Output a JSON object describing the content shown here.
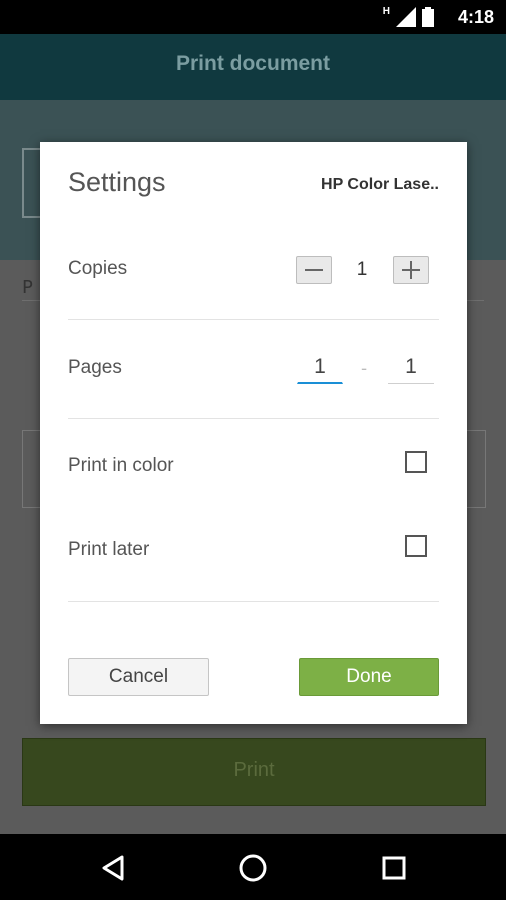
{
  "status_bar": {
    "time": "4:18",
    "network_indicator": "H",
    "icons": [
      "signal-icon",
      "battery-icon"
    ]
  },
  "app_bar": {
    "title": "Print document"
  },
  "background": {
    "print_button_label": "Print"
  },
  "dialog": {
    "title": "Settings",
    "printer": "HP Color Lase..",
    "copies": {
      "label": "Copies",
      "value": "1",
      "minus_icon": "minus-icon",
      "plus_icon": "plus-icon"
    },
    "pages": {
      "label": "Pages",
      "from": "1",
      "separator": "-",
      "to": "1"
    },
    "print_in_color": {
      "label": "Print in color",
      "checked": false
    },
    "print_later": {
      "label": "Print later",
      "checked": false
    },
    "cancel_label": "Cancel",
    "done_label": "Done"
  },
  "colors": {
    "app_bar": "#10393f",
    "done_button": "#7db046",
    "page_from_underline": "#1a8fd6"
  },
  "nav_bar": {
    "icons": [
      "back-icon",
      "home-icon",
      "recents-icon"
    ]
  }
}
